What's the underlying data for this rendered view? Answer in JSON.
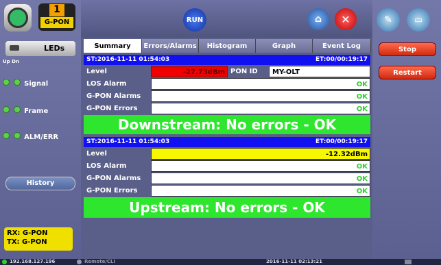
{
  "device": {
    "badge_num": "1",
    "badge_label": "G-PON"
  },
  "run_label": "RUN",
  "left": {
    "leds_label": "LEDs",
    "updn_label": "Up Dn",
    "leds": [
      {
        "label": "Signal"
      },
      {
        "label": "Frame"
      },
      {
        "label": "ALM/ERR"
      }
    ],
    "history_label": "History",
    "rx_label": "RX: G-PON",
    "tx_label": "TX: G-PON"
  },
  "tabs": [
    "Summary",
    "Errors/Alarms",
    "Histogram",
    "Graph",
    "Event Log"
  ],
  "downstream": {
    "start_time": "ST:2016-11-11 01:54:03",
    "elapsed": "ET:00/00:19:17",
    "level_label": "Level",
    "level_value": "-27.73dBm",
    "pon_id_label": "PON ID",
    "pon_id_value": "MY-OLT",
    "rows": [
      {
        "label": "LOS Alarm",
        "value": "OK"
      },
      {
        "label": "G-PON Alarms",
        "value": "OK"
      },
      {
        "label": "G-PON Errors",
        "value": "OK"
      }
    ],
    "banner": "Downstream: No errors - OK"
  },
  "upstream": {
    "start_time": "ST:2016-11-11 01:54:03",
    "elapsed": "ET:00/00:19:17",
    "level_label": "Level",
    "level_value": "-12.32dBm",
    "rows": [
      {
        "label": "LOS Alarm",
        "value": "OK"
      },
      {
        "label": "G-PON Alarms",
        "value": "OK"
      },
      {
        "label": "G-PON Errors",
        "value": "OK"
      }
    ],
    "banner": "Upstream: No errors - OK"
  },
  "right": {
    "stop_label": "Stop",
    "restart_label": "Restart"
  },
  "status": {
    "ip": "192.168.127.196",
    "remote": "Remote/CLI",
    "datetime": "2016-11-11 02:13:21"
  },
  "colors": {
    "level_bad": "#f00000",
    "level_warn": "#f8f800",
    "ok": "#2ecc2e",
    "banner": "#2ee62e",
    "header_bar": "#1010f0"
  }
}
